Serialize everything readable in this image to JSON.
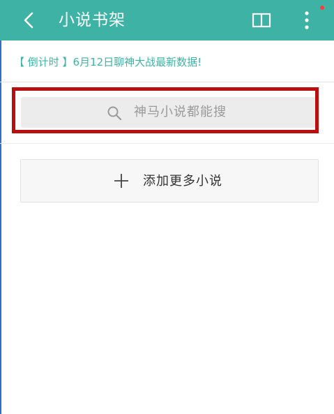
{
  "header": {
    "title": "小说书架",
    "back_icon": "chevron-left-icon",
    "book_icon": "open-book-icon",
    "more_icon": "vertical-dots-icon",
    "bg_color": "#3eb3a5",
    "notification_dot_color": "#ff3b3b"
  },
  "notice": {
    "text": "【 倒计时 】6月12日聊神大战最新数据!",
    "color": "#3eb3a5"
  },
  "search": {
    "placeholder": "神马小说都能搜",
    "icon": "search-icon",
    "highlight_color": "#b80f0f"
  },
  "add_more": {
    "label": "添加更多小说",
    "icon": "plus-icon"
  }
}
